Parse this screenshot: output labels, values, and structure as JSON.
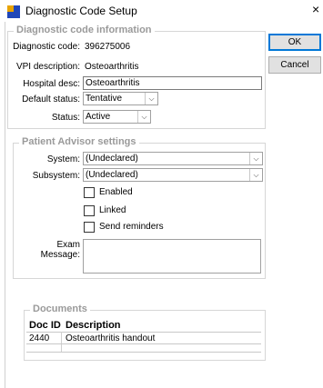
{
  "window": {
    "title": "Diagnostic Code Setup",
    "close_glyph": "×"
  },
  "buttons": {
    "ok": "OK",
    "cancel": "Cancel"
  },
  "code_info": {
    "legend": "Diagnostic code information",
    "diagnostic_code_label": "Diagnostic code:",
    "diagnostic_code_value": "396275006",
    "vpi_label": "VPI description:",
    "vpi_value": "Osteoarthritis",
    "hospital_label": "Hospital desc:",
    "hospital_value": "Osteoarthritis",
    "default_status_label": "Default status:",
    "default_status_value": "Tentative",
    "status_label": "Status:",
    "status_value": "Active"
  },
  "patient_advisor": {
    "legend": "Patient Advisor settings",
    "system_label": "System:",
    "system_value": "(Undeclared)",
    "subsystem_label": "Subsystem:",
    "subsystem_value": "(Undeclared)",
    "enabled_label": "Enabled",
    "enabled_checked": false,
    "linked_label": "Linked",
    "linked_checked": false,
    "send_reminders_label": "Send reminders",
    "send_reminders_checked": false,
    "exam_label_line1": "Exam",
    "exam_label_line2": "Message:",
    "exam_message": ""
  },
  "documents": {
    "legend": "Documents",
    "columns": [
      "Doc ID",
      "Description"
    ],
    "rows": [
      {
        "doc_id": "2440",
        "description": "Osteoarthritis handout"
      }
    ]
  },
  "icons": {
    "app": "app-window-icon",
    "dropdown": "chevron-down-icon",
    "close": "close-icon"
  }
}
